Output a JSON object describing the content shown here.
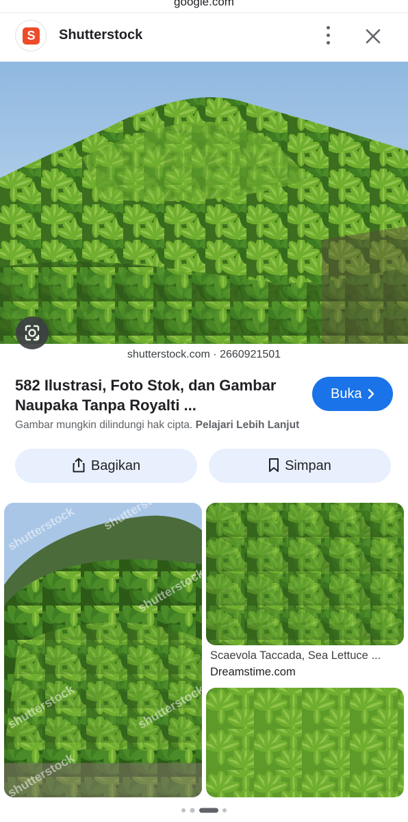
{
  "browser": {
    "url": "google.com"
  },
  "header": {
    "site_name": "Shutterstock",
    "logo_glyph": "S",
    "brand_color": "#ee4b2b",
    "more_icon": "more-vert-icon",
    "close_icon": "close-icon"
  },
  "hero": {
    "source": "shutterstock.com · 2660921501",
    "lens_icon": "lens-icon"
  },
  "result": {
    "title_line1": "582 Ilustrasi, Foto Stok, dan Gambar",
    "title_line2": "Naupaka Tanpa Royalti ...",
    "open_label": "Buka",
    "accent": "#1a73e8",
    "copyright_text": "Gambar mungkin dilindungi hak cipta.",
    "learn_more": "Pelajari Lebih Lanjut"
  },
  "actions": {
    "share_label": "Bagikan",
    "save_label": "Simpan"
  },
  "related": [
    {
      "caption": "",
      "source": "",
      "watermark": "shutterstock"
    },
    {
      "caption": "Scaevola Taccada, Sea Lettuce ...",
      "source": "Dreamstime.com"
    },
    {
      "caption": "",
      "source": ""
    }
  ],
  "pager": {
    "pages": 4,
    "current": 3
  }
}
